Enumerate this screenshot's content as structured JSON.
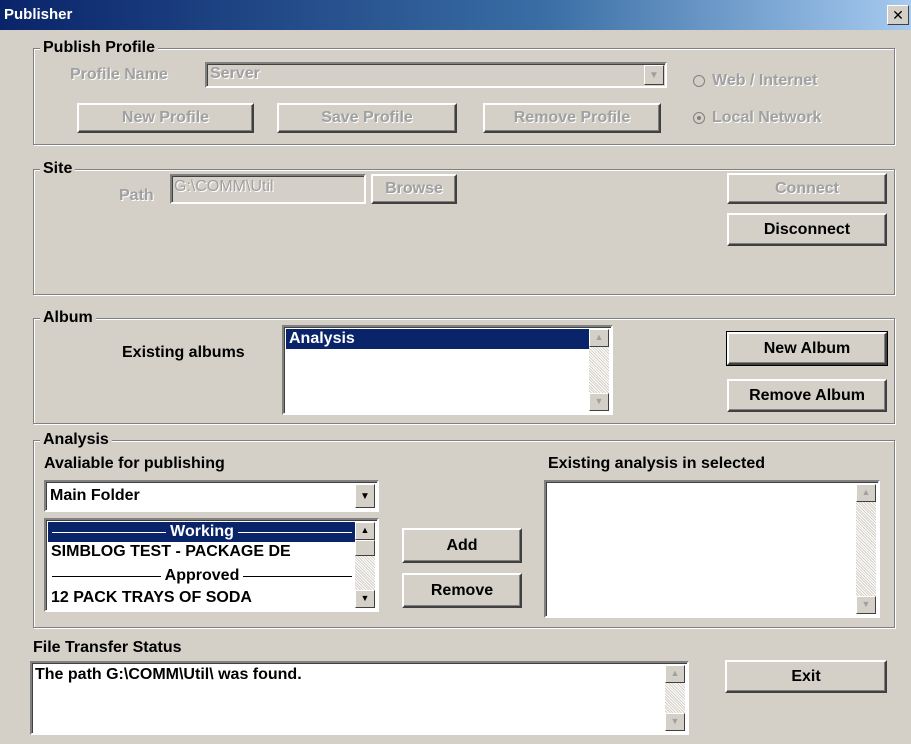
{
  "window": {
    "title": "Publisher",
    "close_glyph": "✕"
  },
  "publish_profile": {
    "legend": "Publish Profile",
    "profile_name_label": "Profile Name",
    "profile_name_value": "Server",
    "new_profile": "New Profile",
    "save_profile": "Save Profile",
    "remove_profile": "Remove Profile",
    "radio_web": "Web / Internet",
    "radio_local": "Local Network",
    "selected_radio": "Local Network"
  },
  "site": {
    "legend": "Site",
    "path_label": "Path",
    "path_value": "G:\\COMM\\Util",
    "browse": "Browse",
    "connect": "Connect",
    "disconnect": "Disconnect"
  },
  "album": {
    "legend": "Album",
    "existing_label": "Existing albums",
    "items": [
      "Analysis"
    ],
    "new_album": "New Album",
    "remove_album": "Remove Album"
  },
  "analysis": {
    "legend": "Analysis",
    "available_label": "Avaliable for publishing",
    "folder_value": "Main Folder",
    "list": {
      "sep1": "Working",
      "item1": "SIMBLOG TEST - PACKAGE DE",
      "sep2": "Approved",
      "item2": "12 PACK TRAYS OF SODA"
    },
    "existing_label": "Existing analysis in selected",
    "add": "Add",
    "remove": "Remove"
  },
  "status": {
    "label": "File Transfer Status",
    "text": "The path G:\\COMM\\Util\\ was found.",
    "exit": "Exit"
  },
  "colors": {
    "title_bar": "#0a246a",
    "selection": "#0a246a",
    "face": "#d4d0c8"
  }
}
